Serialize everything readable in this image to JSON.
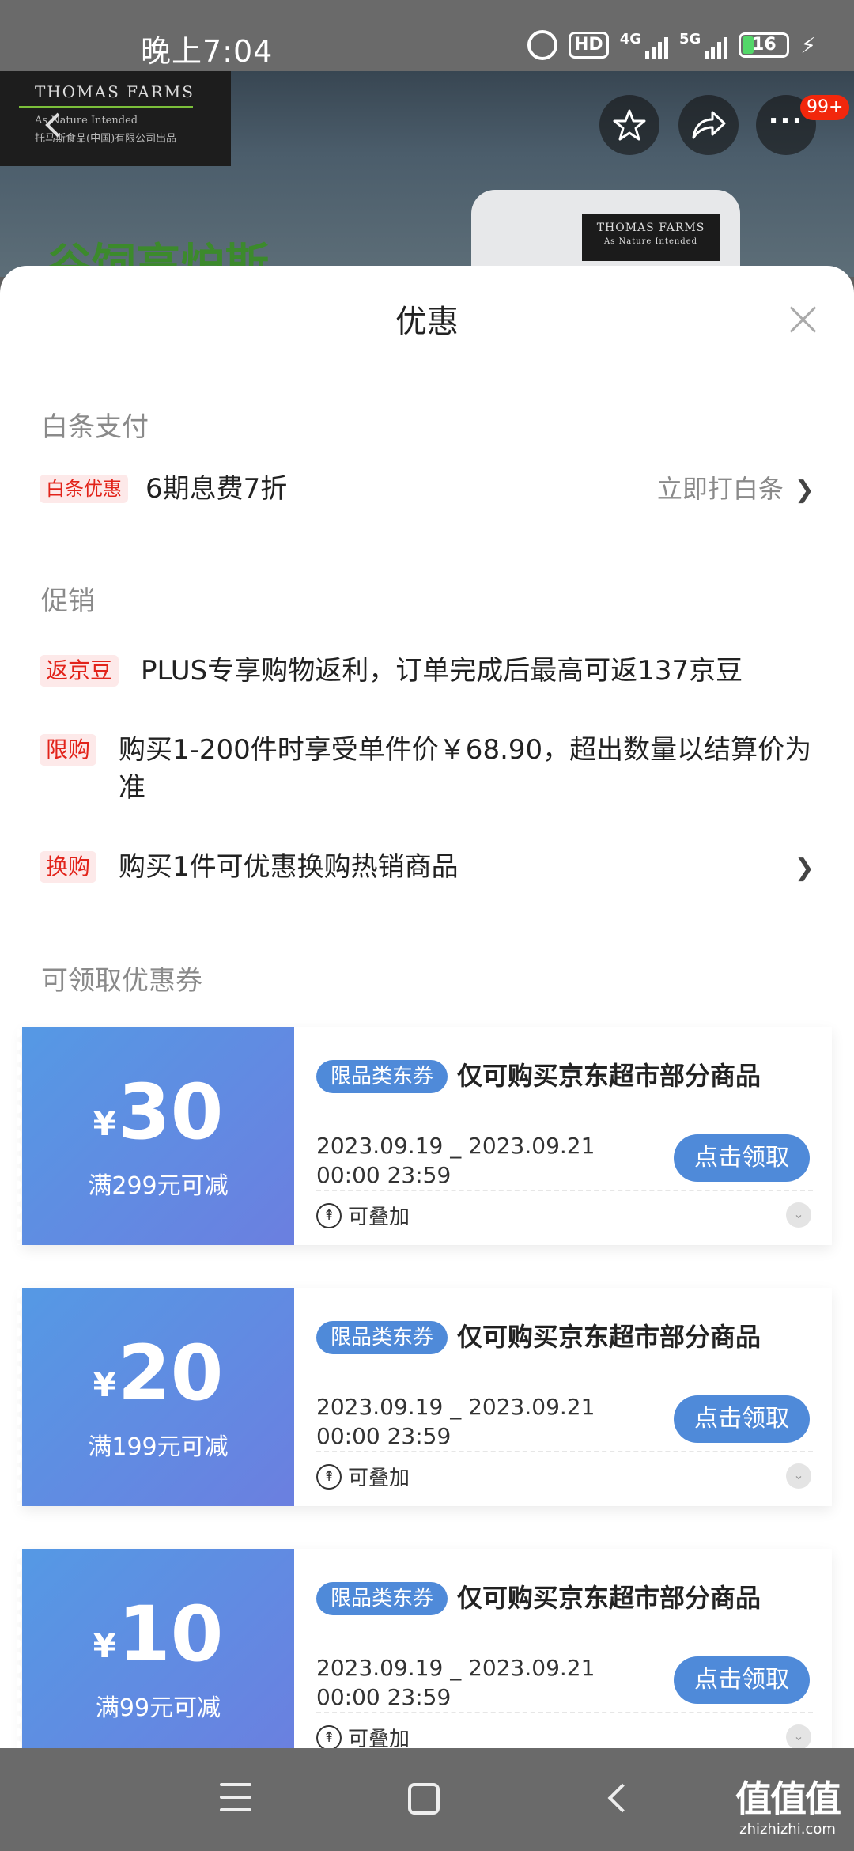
{
  "status_bar": {
    "time": "晚上7:04",
    "hd": "HD",
    "net1": "4G",
    "net2": "5G",
    "battery": "16"
  },
  "product_header": {
    "brand_name": "THOMAS FARMS",
    "brand_tagline": "As Nature Intended",
    "brand_sub": "托马斯食品(中国)有限公司出品",
    "pack_brand": "THOMAS FARMS",
    "pack_tag": "As Nature Intended",
    "green_text": "谷饲高炉斯",
    "badge": "99+"
  },
  "sheet": {
    "title": "优惠",
    "baitiao": {
      "section": "白条支付",
      "tag": "白条优惠",
      "text": "6期息费7折",
      "link": "立即打白条"
    },
    "promo": {
      "section": "促销",
      "items": [
        {
          "tag": "返京豆",
          "text": "PLUS专享购物返利，订单完成后最高可返137京豆"
        },
        {
          "tag": "限购",
          "text": "购买1-200件时享受单件价￥68.90，超出数量以结算价为准"
        },
        {
          "tag": "换购",
          "text": "购买1件可优惠换购热销商品"
        }
      ]
    },
    "coupons_section": "可领取优惠券",
    "coupons": [
      {
        "yen": "¥",
        "amount": "30",
        "cond": "满299元可减",
        "tag": "限品类东券",
        "desc": "仅可购买京东超市部分商品",
        "date1": "2023.09.19 _ 2023.09.21",
        "date2": "00:00 23:59",
        "stack": "可叠加",
        "button": "点击领取"
      },
      {
        "yen": "¥",
        "amount": "20",
        "cond": "满199元可减",
        "tag": "限品类东券",
        "desc": "仅可购买京东超市部分商品",
        "date1": "2023.09.19 _ 2023.09.21",
        "date2": "00:00 23:59",
        "stack": "可叠加",
        "button": "点击领取"
      },
      {
        "yen": "¥",
        "amount": "10",
        "cond": "满99元可减",
        "tag": "限品类东券",
        "desc": "仅可购买京东超市部分商品",
        "date1": "2023.09.19 _ 2023.09.21",
        "date2": "00:00 23:59",
        "stack": "可叠加",
        "button": "点击领取"
      }
    ]
  },
  "watermark": {
    "main": "值值值",
    "sub": "zhizhizhi.com"
  },
  "colors": {
    "red_tag_bg": "#fde9e9",
    "red_tag_text": "#e2231a",
    "coupon_blue": "#4f8ad9",
    "coupon_gradient_start": "#5599e4",
    "coupon_gradient_end": "#6b7fe0"
  }
}
